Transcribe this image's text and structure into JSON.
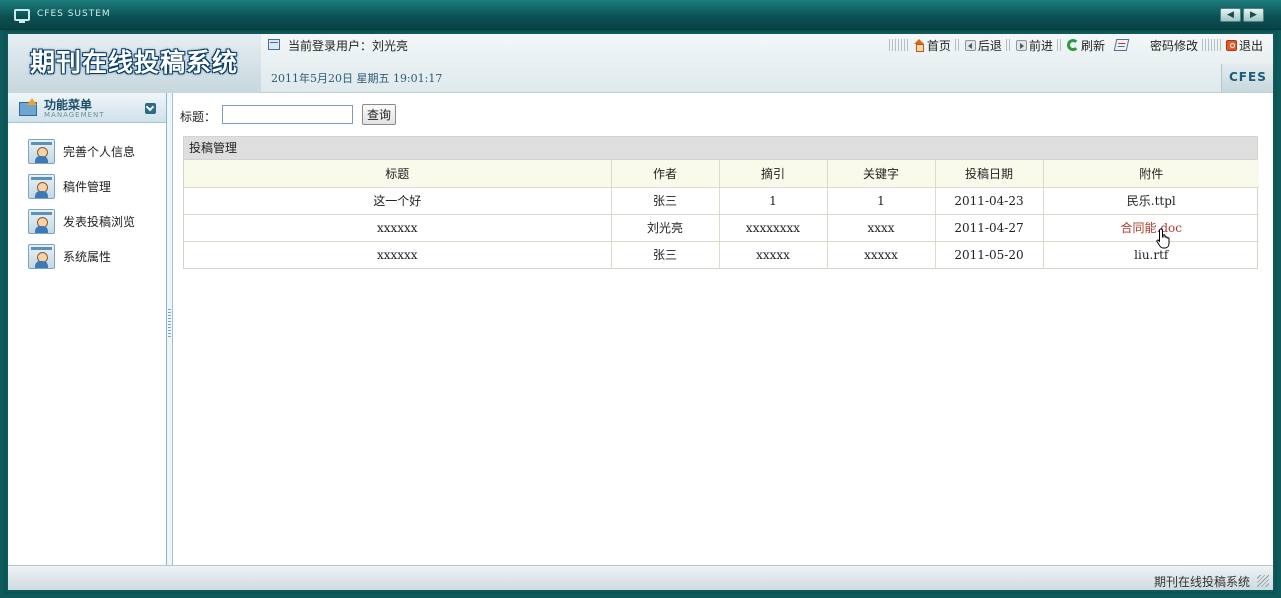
{
  "window": {
    "system_title": "CFES SUSTEM",
    "nav_prev": "◀",
    "nav_next": "▶"
  },
  "header": {
    "app_title": "期刊在线投稿系统",
    "current_user_label": "当前登录用户：刘光亮",
    "datetime": "2011年5月20日  星期五  19:01:17",
    "brand": "CFES",
    "links": {
      "home": "首页",
      "back": "后退",
      "forward": "前进",
      "refresh": "刷新",
      "change_password": "密码修改",
      "logout": "退出"
    }
  },
  "sidebar": {
    "title": "功能菜单",
    "subtitle": "MANAGEMENT",
    "items": [
      {
        "label": "完善个人信息"
      },
      {
        "label": "稿件管理"
      },
      {
        "label": "发表投稿浏览"
      },
      {
        "label": "系统属性"
      }
    ]
  },
  "search": {
    "label": "标题：",
    "value": "",
    "button": "查询"
  },
  "panel": {
    "title": "投稿管理",
    "columns": [
      "标题",
      "作者",
      "摘引",
      "关键字",
      "投稿日期",
      "附件"
    ],
    "rows": [
      {
        "title": "这一个好",
        "author": "张三",
        "abstract": "1",
        "keywords": "1",
        "date": "2011-04-23",
        "attachment": "民乐.ttpl"
      },
      {
        "title": "xxxxxx",
        "author": "刘光亮",
        "abstract": "xxxxxxxx",
        "keywords": "xxxx",
        "date": "2011-04-27",
        "attachment": "合同能.doc"
      },
      {
        "title": "xxxxxx",
        "author": "张三",
        "abstract": "xxxxx",
        "keywords": "xxxxx",
        "date": "2011-05-20",
        "attachment": "liu.rtf"
      }
    ]
  },
  "footer": {
    "text": "期刊在线投稿系统"
  },
  "colors": {
    "frame": "#0e5a5a",
    "link_hover": "#b03a2e",
    "header_bg": "#dfe9ec"
  }
}
